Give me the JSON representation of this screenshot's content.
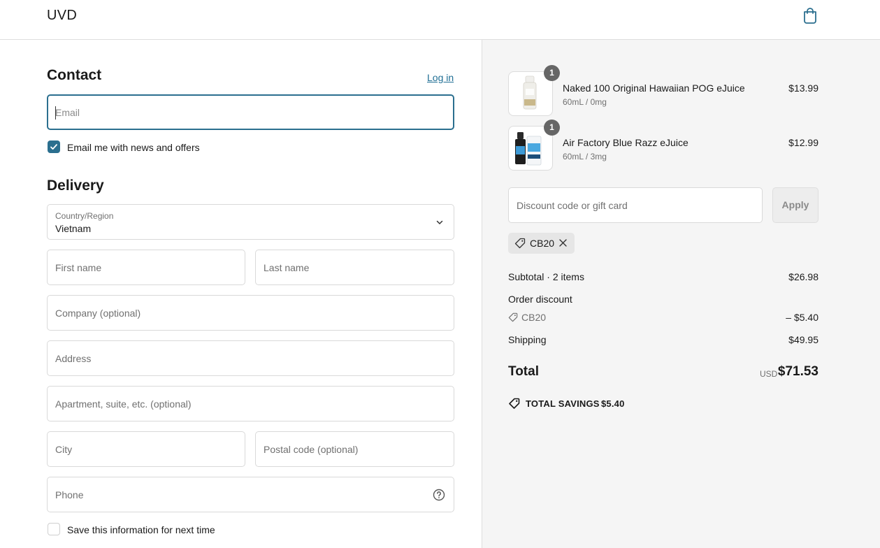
{
  "header": {
    "brand": "UVD",
    "cart_icon": "shopping-bag-icon"
  },
  "contact": {
    "title": "Contact",
    "login_link": "Log in",
    "email_placeholder": "Email",
    "news_checkbox_label": "Email me with news and offers",
    "news_checked": true
  },
  "delivery": {
    "title": "Delivery",
    "country_label": "Country/Region",
    "country_value": "Vietnam",
    "first_name_placeholder": "First name",
    "last_name_placeholder": "Last name",
    "company_placeholder": "Company (optional)",
    "address_placeholder": "Address",
    "apartment_placeholder": "Apartment, suite, etc. (optional)",
    "city_placeholder": "City",
    "postal_placeholder": "Postal code (optional)",
    "phone_placeholder": "Phone",
    "save_info_label": "Save this information for next time",
    "save_info_checked": false
  },
  "order": {
    "items": [
      {
        "name": "Naked 100 Original Hawaiian POG eJuice",
        "variant": "60mL / 0mg",
        "price": "$13.99",
        "quantity": "1"
      },
      {
        "name": "Air Factory Blue Razz eJuice",
        "variant": "60mL / 3mg",
        "price": "$12.99",
        "quantity": "1"
      }
    ],
    "discount_placeholder": "Discount code or gift card",
    "apply_label": "Apply",
    "applied_code": "CB20",
    "subtotal_label": "Subtotal · 2 items",
    "subtotal_value": "$26.98",
    "order_discount_label": "Order discount",
    "discount_code": "CB20",
    "discount_value": "– $5.40",
    "shipping_label": "Shipping",
    "shipping_value": "$49.95",
    "total_label": "Total",
    "currency": "USD",
    "total_value": "$71.53",
    "savings_label": "TOTAL SAVINGS",
    "savings_value": "$5.40"
  },
  "colors": {
    "accent": "#2b6f8f",
    "link": "#1f6e94",
    "summary_bg": "#f5f5f5"
  }
}
